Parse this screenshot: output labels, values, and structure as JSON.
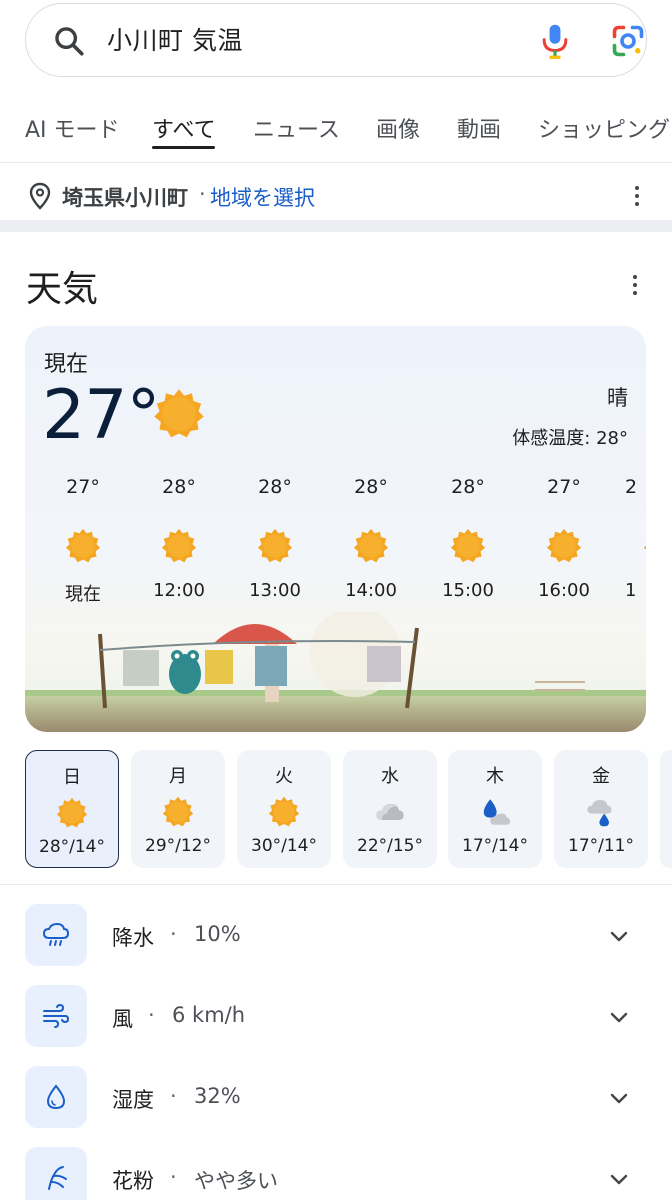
{
  "search": {
    "query": "小川町 気温"
  },
  "tabs": [
    "AI モード",
    "すべて",
    "ニュース",
    "画像",
    "動画",
    "ショッピング"
  ],
  "location": {
    "place": "埼玉県小川町",
    "separator": "·",
    "change_label": "地域を選択"
  },
  "weather": {
    "title": "天気",
    "now_label": "現在",
    "current_temp": "27°",
    "condition": "晴",
    "feels_like": "体感温度: 28°",
    "hourly": [
      {
        "temp": "27°",
        "time": "現在",
        "icon": "sun-icon"
      },
      {
        "temp": "28°",
        "time": "12:00",
        "icon": "sun-icon"
      },
      {
        "temp": "28°",
        "time": "13:00",
        "icon": "sun-icon"
      },
      {
        "temp": "28°",
        "time": "14:00",
        "icon": "sun-icon"
      },
      {
        "temp": "28°",
        "time": "15:00",
        "icon": "sun-icon"
      },
      {
        "temp": "27°",
        "time": "16:00",
        "icon": "sun-icon"
      },
      {
        "temp": "2",
        "time": "1",
        "icon": "sun-icon"
      }
    ],
    "daily": [
      {
        "day": "日",
        "temps": "28°/14°",
        "icon": "sun-icon",
        "selected": true
      },
      {
        "day": "月",
        "temps": "29°/12°",
        "icon": "sun-icon"
      },
      {
        "day": "火",
        "temps": "30°/14°",
        "icon": "sun-icon"
      },
      {
        "day": "水",
        "temps": "22°/15°",
        "icon": "cloud-icon"
      },
      {
        "day": "木",
        "temps": "17°/14°",
        "icon": "rain-cloud-icon"
      },
      {
        "day": "金",
        "temps": "17°/11°",
        "icon": "cloud-rain-icon"
      }
    ],
    "details": [
      {
        "label": "降水",
        "value": "10%",
        "icon": "rain-cloud-icon"
      },
      {
        "label": "風",
        "value": "6 km/h",
        "icon": "wind-icon"
      },
      {
        "label": "湿度",
        "value": "32%",
        "icon": "humidity-drop-icon"
      },
      {
        "label": "花粉",
        "value": "やや多い",
        "icon": "pollen-icon"
      }
    ],
    "detail_separator": "·"
  },
  "colors": {
    "sun": "#f5a623",
    "link": "#1a5fc7",
    "icon_bg": "#e8f0fe",
    "icon_fg": "#1a5fc7"
  }
}
